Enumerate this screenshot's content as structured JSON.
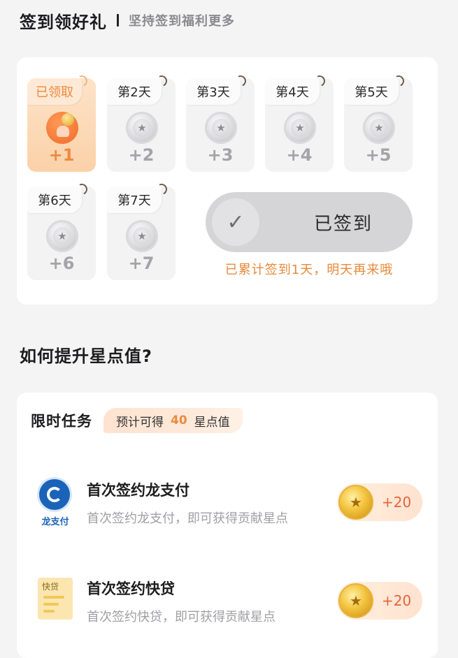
{
  "header": {
    "title": "签到领好礼",
    "subtitle": "坚持签到福利更多"
  },
  "checkin": {
    "days": [
      {
        "label": "已领取",
        "reward": "+1",
        "state": "claimed"
      },
      {
        "label": "第2天",
        "reward": "+2",
        "state": "pending"
      },
      {
        "label": "第3天",
        "reward": "+3",
        "state": "pending"
      },
      {
        "label": "第4天",
        "reward": "+4",
        "state": "pending"
      },
      {
        "label": "第5天",
        "reward": "+5",
        "state": "pending"
      },
      {
        "label": "第6天",
        "reward": "+6",
        "state": "pending"
      },
      {
        "label": "第7天",
        "reward": "+7",
        "state": "pending"
      }
    ],
    "button_label": "已签到",
    "streak_text": "已累计签到1天，明天再来哦"
  },
  "boost": {
    "title": "如何提升星点值?"
  },
  "tasks": {
    "title": "限时任务",
    "estimate_prefix": "预计可得",
    "estimate_value": "40",
    "estimate_suffix": "星点值",
    "items": [
      {
        "name": "首次签约龙支付",
        "desc": "首次签约龙支付，即可获得贡献星点",
        "points": "+20",
        "logo_caption": "龙支付",
        "icon": "long-pay-icon"
      },
      {
        "name": "首次签约快贷",
        "desc": "首次签约快贷，即可获得贡献星点",
        "points": "+20",
        "logo_caption": "快贷",
        "icon": "quick-loan-icon"
      }
    ]
  },
  "colors": {
    "accent": "#E88B3E",
    "points_text": "#E4643A",
    "background": "#F4F4F5"
  }
}
